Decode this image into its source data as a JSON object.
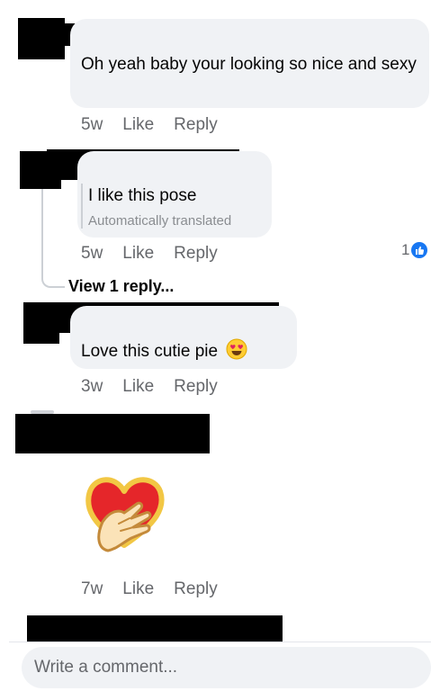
{
  "comments": [
    {
      "text": "Oh yeah baby your looking so nice and sexy",
      "time": "5w",
      "like_label": "Like",
      "reply_label": "Reply"
    },
    {
      "text": "I like this pose",
      "subtext": "Automatically translated",
      "time": "5w",
      "like_label": "Like",
      "reply_label": "Reply",
      "reaction_count": "1"
    },
    {
      "text": "Love this cutie pie",
      "emoji": "😍",
      "time": "3w",
      "like_label": "Like",
      "reply_label": "Reply"
    },
    {
      "sticker": "heart-hand-sticker",
      "time": "7w",
      "like_label": "Like",
      "reply_label": "Reply"
    }
  ],
  "view_replies_label": "View 1 reply...",
  "composer": {
    "placeholder": "Write a comment..."
  },
  "colors": {
    "bubble": "#f0f2f5",
    "meta": "#65676b",
    "like_blue": "#1877f2",
    "redaction": "#000000"
  },
  "icons": {
    "reaction": "like-icon",
    "emoji": "heart-eyes-emoji"
  }
}
